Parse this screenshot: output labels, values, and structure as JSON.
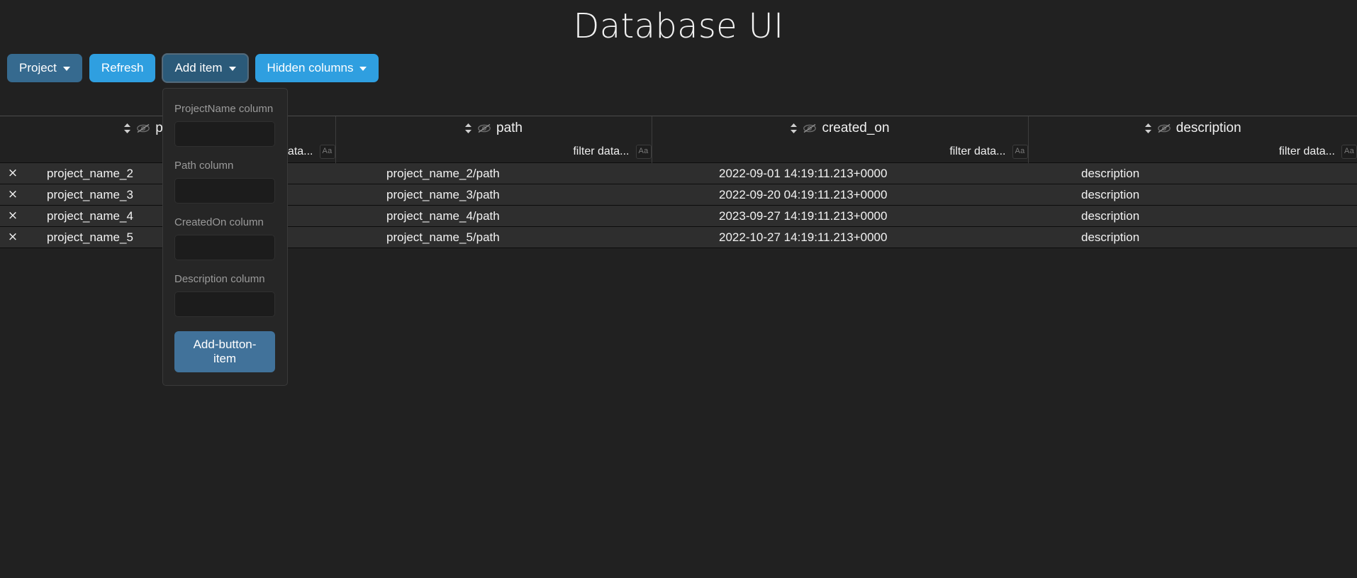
{
  "page": {
    "title": "Database UI",
    "background_color": "#212121"
  },
  "toolbar": {
    "buttons": [
      {
        "label": "Project",
        "caret": true,
        "style": "muted",
        "color": "#366a8f"
      },
      {
        "label": "Refresh",
        "caret": false,
        "style": "primary",
        "color": "#2f9fe0"
      },
      {
        "label": "Add item",
        "caret": true,
        "style": "active",
        "color": "#2b5a79"
      },
      {
        "label": "Hidden columns",
        "caret": true,
        "style": "primary",
        "color": "#2f9fe0"
      }
    ]
  },
  "add_item_dropdown": {
    "open": true,
    "fields": [
      {
        "label": "ProjectName column",
        "value": "",
        "placeholder": ""
      },
      {
        "label": "Path column",
        "value": "",
        "placeholder": ""
      },
      {
        "label": "CreatedOn column",
        "value": "",
        "placeholder": ""
      },
      {
        "label": "Description column",
        "value": "",
        "placeholder": ""
      }
    ],
    "submit_label": "Add-button-item"
  },
  "table": {
    "filter_placeholder": "filter data...",
    "filter_type_badge": "Aa",
    "row_delete_glyph": "×",
    "columns": [
      {
        "key": "project_name",
        "label": "project_name",
        "sortable": true,
        "hideable": true
      },
      {
        "key": "path",
        "label": "path",
        "sortable": true,
        "hideable": true
      },
      {
        "key": "created_on",
        "label": "created_on",
        "sortable": true,
        "hideable": true
      },
      {
        "key": "description",
        "label": "description",
        "sortable": true,
        "hideable": true
      }
    ],
    "rows": [
      {
        "project_name": "project_name_2",
        "path": "project_name_2/path",
        "created_on": "2022-09-01 14:19:11.213+0000",
        "description": "description"
      },
      {
        "project_name": "project_name_3",
        "path": "project_name_3/path",
        "created_on": "2022-09-20 04:19:11.213+0000",
        "description": "description"
      },
      {
        "project_name": "project_name_4",
        "path": "project_name_4/path",
        "created_on": "2023-09-27 14:19:11.213+0000",
        "description": "description"
      },
      {
        "project_name": "project_name_5",
        "path": "project_name_5/path",
        "created_on": "2022-10-27 14:19:11.213+0000",
        "description": "description"
      }
    ]
  }
}
